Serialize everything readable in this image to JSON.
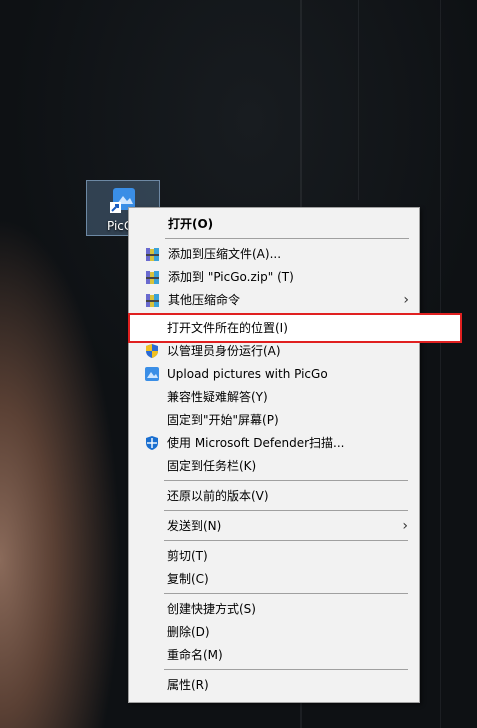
{
  "desktop_icon": {
    "label": "PicGo"
  },
  "menu": {
    "items": [
      {
        "label": "打开(O)"
      },
      {
        "label": "添加到压缩文件(A)..."
      },
      {
        "label": "添加到 \"PicGo.zip\" (T)"
      },
      {
        "label": "其他压缩命令"
      },
      {
        "label": "打开文件所在的位置(I)"
      },
      {
        "label": "以管理员身份运行(A)"
      },
      {
        "label": "Upload pictures with PicGo"
      },
      {
        "label": "兼容性疑难解答(Y)"
      },
      {
        "label": "固定到\"开始\"屏幕(P)"
      },
      {
        "label": "使用 Microsoft Defender扫描..."
      },
      {
        "label": "固定到任务栏(K)"
      },
      {
        "label": "还原以前的版本(V)"
      },
      {
        "label": "发送到(N)"
      },
      {
        "label": "剪切(T)"
      },
      {
        "label": "复制(C)"
      },
      {
        "label": "创建快捷方式(S)"
      },
      {
        "label": "删除(D)"
      },
      {
        "label": "重命名(M)"
      },
      {
        "label": "属性(R)"
      }
    ],
    "submenu_arrow": "›"
  },
  "colors": {
    "highlight_border": "#e02020",
    "menu_bg": "#f2f2f2"
  }
}
